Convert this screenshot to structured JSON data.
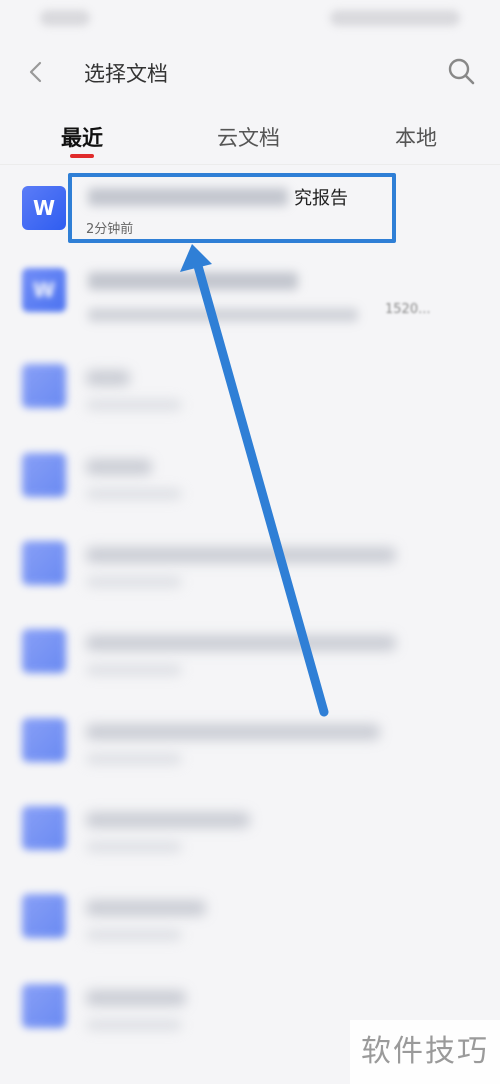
{
  "header": {
    "title": "选择文档",
    "back_icon": "chevron-left-icon",
    "search_icon": "search-icon"
  },
  "tabs": [
    {
      "label": "最近",
      "active": true
    },
    {
      "label": "云文档",
      "active": false
    },
    {
      "label": "本地",
      "active": false
    }
  ],
  "documents": [
    {
      "icon_letter": "W",
      "title_visible_suffix": "究报告",
      "meta": "2分钟前",
      "highlighted": true
    },
    {
      "icon_letter": "W",
      "title_visible_suffix": "",
      "meta_visible_suffix": "1520...",
      "highlighted": false
    }
  ],
  "colors": {
    "accent_red": "#e02b2b",
    "highlight_blue": "#2f7fd6",
    "word_icon_blue": "#2f5df0"
  },
  "watermark": "软件技巧"
}
